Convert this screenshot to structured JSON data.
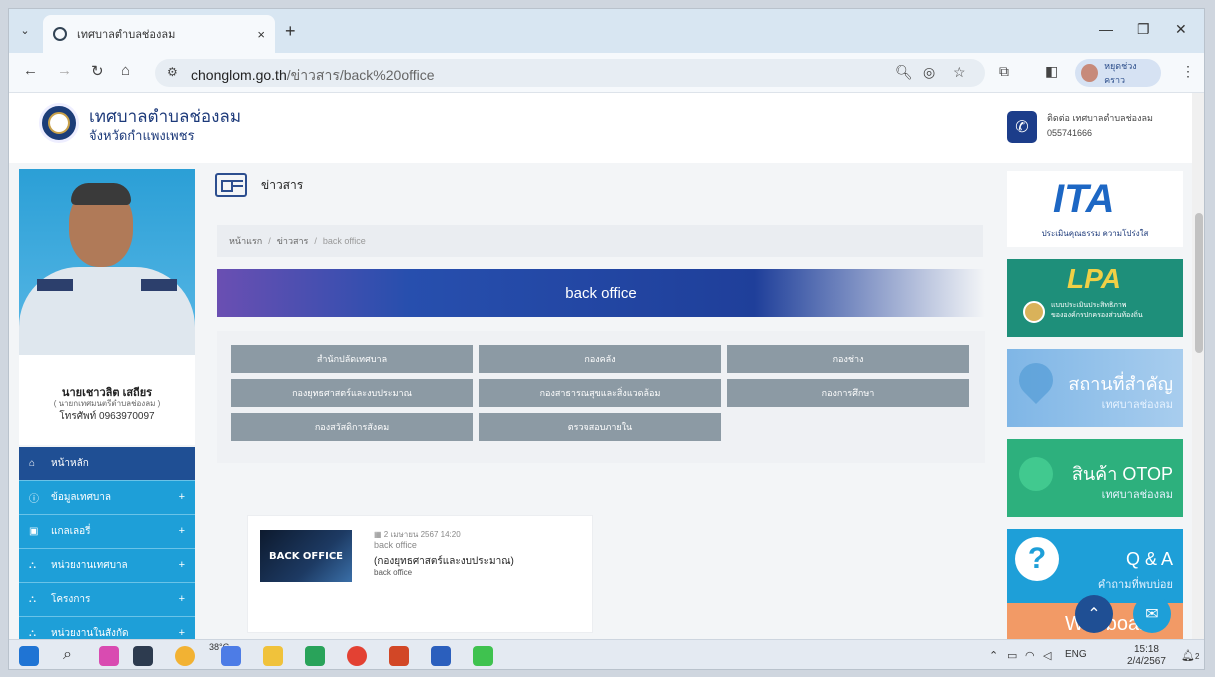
{
  "browser": {
    "tab_title": "เทศบาลตำบลช่องลม",
    "tab_close": "×",
    "new_tab": "+",
    "url_host": "chonglom.go.th",
    "url_path": "/ข่าวสาร/back%20office",
    "profile_name": "หยุดช่วงคราว",
    "icons": [
      "back-icon",
      "forward-icon",
      "reload-icon",
      "home-icon",
      "zoom-icon",
      "eye-off-icon",
      "star-icon",
      "extensions-icon",
      "sidepanel-icon",
      "menu-icon"
    ]
  },
  "header": {
    "site_name": "เทศบาลตำบลช่องลม",
    "site_sub": "จังหวัดกำแพงเพชร",
    "contact_label": "ติดต่อ เทศบาลตำบลช่องลม",
    "contact_phone": "055741666"
  },
  "profile": {
    "name": "นายเชาวลิต เสถียร",
    "position": "( นายกเทศมนตรีตำบลช่องลม )",
    "phone": "โทรศัพท์ 0963970097"
  },
  "menu": [
    {
      "label": "หน้าหลัก",
      "icon": "home-icon",
      "active": true,
      "plus": ""
    },
    {
      "label": "ข้อมูลเทศบาล",
      "icon": "info-icon",
      "active": false,
      "plus": "+"
    },
    {
      "label": "แกลเลอรี่",
      "icon": "gallery-icon",
      "active": false,
      "plus": "+"
    },
    {
      "label": "หน่วยงานเทศบาล",
      "icon": "org-icon",
      "active": false,
      "plus": "+"
    },
    {
      "label": "โครงการ",
      "icon": "org-icon",
      "active": false,
      "plus": "+"
    },
    {
      "label": "หน่วยงานในสังกัด",
      "icon": "org-icon",
      "active": false,
      "plus": "+"
    }
  ],
  "main": {
    "section_title": "ข่าวสาร",
    "breadcrumb": [
      "หน้าแรก",
      "ข่าวสาร",
      "back office"
    ],
    "banner": "back office",
    "categories": [
      "สำนักปลัดเทศบาล",
      "กองคลัง",
      "กองช่าง",
      "กองยุทธศาสตร์และงบประมาณ",
      "กองสาธารณสุขและสิ่งแวดล้อม",
      "กองการศึกษา",
      "กองสวัสดิการสังคม",
      "ตรวจสอบภายใน"
    ],
    "post": {
      "thumb_text": "BACK OFFICE",
      "date": "2 เมษายน 2567 14:20",
      "category": "back office",
      "title": "(กองยุทธศาสตร์และงบประมาณ)",
      "subtitle": "back office"
    }
  },
  "right": {
    "ita_big": "ITA",
    "ita_caption": "ประเมินคุณธรรม ความโปร่งใส",
    "lpa_big": "LPA",
    "lpa_caption_1": "แบบประเมินประสิทธิภาพ",
    "lpa_caption_2": "ขององค์กรปกครองส่วนท้องถิ่น",
    "place_title": "สถานที่สำคัญ",
    "place_sub": "เทศบาลช่องลม",
    "otop_title": "สินค้า OTOP",
    "otop_sub": "เทศบาลช่องลม",
    "qa_title": "Q & A",
    "qa_sub": "คำถามที่พบบ่อย",
    "webboard": "Webboard"
  },
  "taskbar": {
    "temp": "38°C",
    "lang": "ENG",
    "time": "15:18",
    "date": "2/4/2567",
    "notif_count": "2"
  }
}
